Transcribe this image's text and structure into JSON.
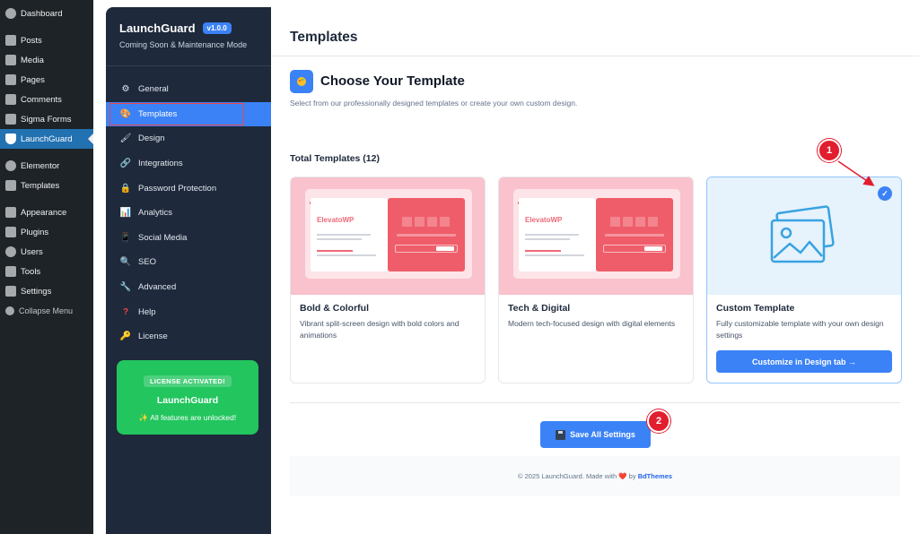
{
  "wp_menu": {
    "items": [
      {
        "label": "Dashboard"
      },
      {
        "label": "Posts"
      },
      {
        "label": "Media"
      },
      {
        "label": "Pages"
      },
      {
        "label": "Comments"
      },
      {
        "label": "Sigma Forms"
      },
      {
        "label": "LaunchGuard"
      },
      {
        "label": "Elementor"
      },
      {
        "label": "Templates"
      },
      {
        "label": "Appearance"
      },
      {
        "label": "Plugins"
      },
      {
        "label": "Users"
      },
      {
        "label": "Tools"
      },
      {
        "label": "Settings"
      },
      {
        "label": "Collapse Menu"
      }
    ]
  },
  "plugin": {
    "name": "LaunchGuard",
    "version": "v1.0.0",
    "subtitle": "Coming Soon & Maintenance Mode",
    "nav": [
      {
        "label": "General",
        "icon": "gear-icon"
      },
      {
        "label": "Templates",
        "icon": "palette-icon"
      },
      {
        "label": "Design",
        "icon": "brush-icon"
      },
      {
        "label": "Integrations",
        "icon": "link-icon"
      },
      {
        "label": "Password Protection",
        "icon": "lock-icon"
      },
      {
        "label": "Analytics",
        "icon": "chart-icon"
      },
      {
        "label": "Social Media",
        "icon": "phone-icon"
      },
      {
        "label": "SEO",
        "icon": "magnifier-icon"
      },
      {
        "label": "Advanced",
        "icon": "wrench-icon"
      },
      {
        "label": "Help",
        "icon": "question-icon"
      },
      {
        "label": "License",
        "icon": "key-icon"
      }
    ],
    "license": {
      "badge": "LICENSE ACTIVATED!",
      "name": "LaunchGuard",
      "note": "✨ All features are unlocked!"
    }
  },
  "main": {
    "page_title": "Templates",
    "choose_title": "Choose Your Template",
    "choose_subtitle": "Select from our professionally designed templates or create your own custom design.",
    "total_label": "Total Templates (12)",
    "templates": [
      {
        "name": "Bold & Colorful",
        "description": "Vibrant split-screen design with bold colors and animations",
        "preview_brand": "ElevatoWP"
      },
      {
        "name": "Tech & Digital",
        "description": "Modern tech-focused design with digital elements",
        "preview_brand": "ElevatoWP"
      },
      {
        "name": "Custom Template",
        "description": "Fully customizable template with your own design settings",
        "button": "Customize in Design tab →",
        "selected": true
      }
    ],
    "save_button": "Save All Settings",
    "footer": {
      "prefix": "© 2025 LaunchGuard. Made with",
      "heart": "❤️",
      "by": "by",
      "link": "BdThemes"
    }
  },
  "annotations": {
    "marker_1": "1",
    "marker_2": "2"
  },
  "colors": {
    "wp_sidebar": "#1d2327",
    "plugin_sidebar": "#1e293b",
    "accent": "#3b82f6",
    "license_green": "#22c55e",
    "marker_red": "#e11d2e"
  }
}
